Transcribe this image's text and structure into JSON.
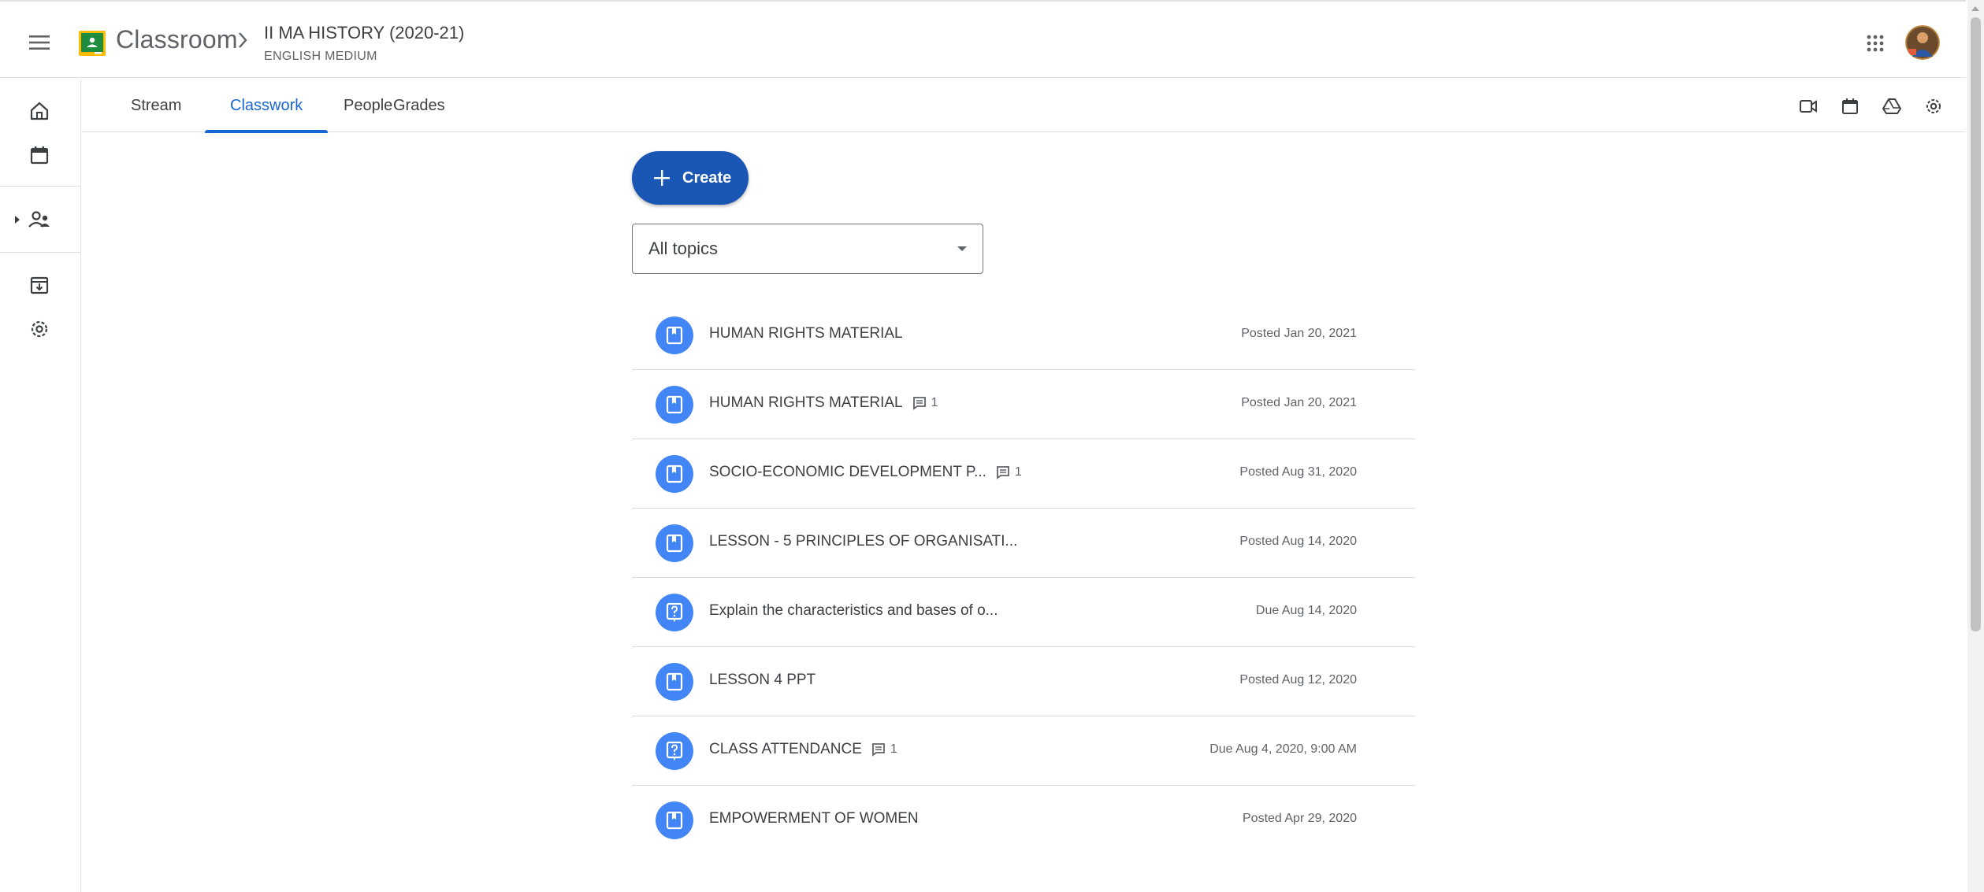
{
  "header": {
    "app_title": "Classroom",
    "class_title": "II MA HISTORY (2020-21)",
    "class_subtitle": "ENGLISH MEDIUM"
  },
  "tabs": [
    {
      "label": "Stream",
      "active": false
    },
    {
      "label": "Classwork",
      "active": true
    },
    {
      "label": "People",
      "active": false
    },
    {
      "label": "Grades",
      "active": false
    }
  ],
  "main": {
    "create_label": "Create",
    "topic_filter": "All topics",
    "items": [
      {
        "type": "material",
        "title": "HUMAN RIGHTS MATERIAL",
        "comments": "",
        "meta": "Posted Jan 20, 2021"
      },
      {
        "type": "material",
        "title": "HUMAN RIGHTS MATERIAL",
        "comments": "1",
        "meta": "Posted Jan 20, 2021"
      },
      {
        "type": "material",
        "title": "SOCIO-ECONOMIC DEVELOPMENT P...",
        "comments": "1",
        "meta": "Posted Aug 31, 2020"
      },
      {
        "type": "material",
        "title": "LESSON - 5 PRINCIPLES OF ORGANISATI...",
        "comments": "",
        "meta": "Posted Aug 14, 2020"
      },
      {
        "type": "question",
        "title": "Explain the characteristics and bases of o...",
        "comments": "",
        "meta": "Due Aug 14, 2020"
      },
      {
        "type": "material",
        "title": "LESSON 4 PPT",
        "comments": "",
        "meta": "Posted Aug 12, 2020"
      },
      {
        "type": "question",
        "title": "CLASS ATTENDANCE",
        "comments": "1",
        "meta": "Due Aug 4, 2020, 9:00 AM"
      },
      {
        "type": "material",
        "title": "EMPOWERMENT OF WOMEN",
        "comments": "",
        "meta": "Posted Apr 29, 2020"
      }
    ]
  },
  "colors": {
    "accent": "#1967d2",
    "create_button": "#1a56b4",
    "item_icon": "#4285f4",
    "logo_green": "#1e8e3e",
    "logo_yellow": "#fbbc04"
  },
  "icons": {
    "menu": "hamburger-menu-icon",
    "apps": "google-apps-icon",
    "rail": [
      "home-icon",
      "calendar-icon",
      "enrolled-classes-icon",
      "to-do-icon",
      "settings-icon"
    ],
    "tab_tools": [
      "meet-video-icon",
      "calendar-icon",
      "drive-icon",
      "settings-icon"
    ]
  }
}
